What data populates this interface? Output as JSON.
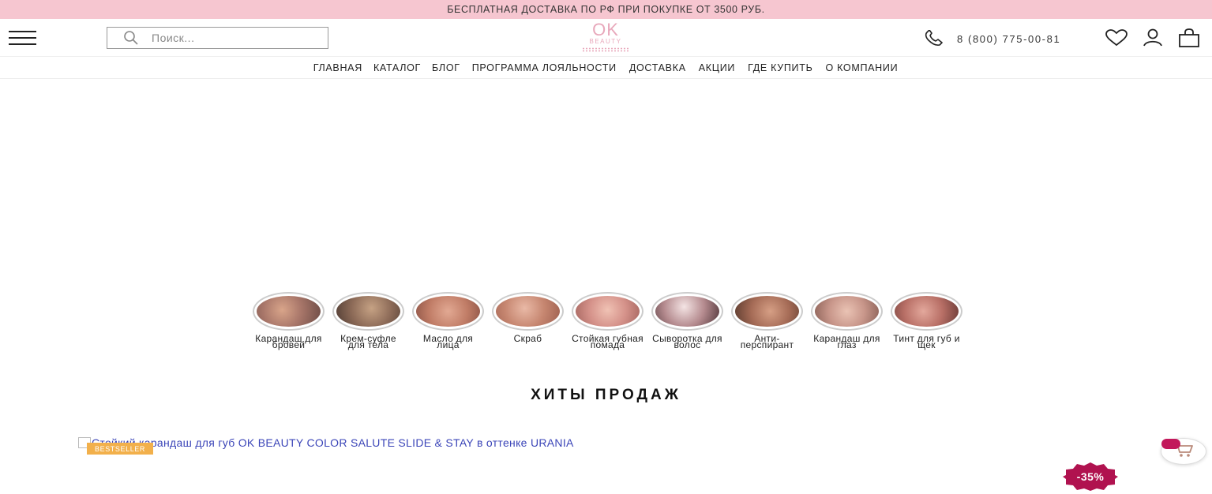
{
  "promo": {
    "text": "БЕСПЛАТНАЯ ДОСТАВКА ПО РФ ПРИ ПОКУПКЕ ОТ 3500 РУБ."
  },
  "header": {
    "search_placeholder": "Поиск...",
    "logo_top": "OK",
    "logo_bottom": "BEAUTY",
    "phone": "8 (800) 775-00-81",
    "icons": [
      "menu-icon",
      "search-icon",
      "phone-icon",
      "heart-icon",
      "user-icon",
      "bag-icon"
    ]
  },
  "nav": {
    "items": [
      "ГЛАВНАЯ",
      "КАТАЛОГ",
      "БЛОГ",
      "ПРОГРАММА ЛОЯЛЬНОСТИ",
      "ДОСТАВКА",
      "АКЦИИ",
      "ГДЕ КУПИТЬ",
      "О КОМПАНИИ"
    ]
  },
  "categories": [
    {
      "label": "Карандаш для бровей"
    },
    {
      "label": "Крем-суфле для тела"
    },
    {
      "label": "Масло для лица"
    },
    {
      "label": "Скраб"
    },
    {
      "label": "Стойкая губная помада"
    },
    {
      "label": "Сыворотка для волос"
    },
    {
      "label": "Анти-перспирант"
    },
    {
      "label": "Карандаш для глаз"
    },
    {
      "label": "Тинт для губ и щек"
    }
  ],
  "hits": {
    "title": "ХИТЫ ПРОДАЖ",
    "product_alt": "Стойкий карандаш для губ OK BEAUTY COLOR SALUTE SLIDE & STAY в оттенке URANIA",
    "badge": "BESTSELLER",
    "discount": "-35%"
  },
  "colors": {
    "promo_bg": "#f6c6d0",
    "logo": "#e8a8bb",
    "badge": "#f2b04b",
    "discount": "#b0124f",
    "link": "#3b45b8"
  }
}
